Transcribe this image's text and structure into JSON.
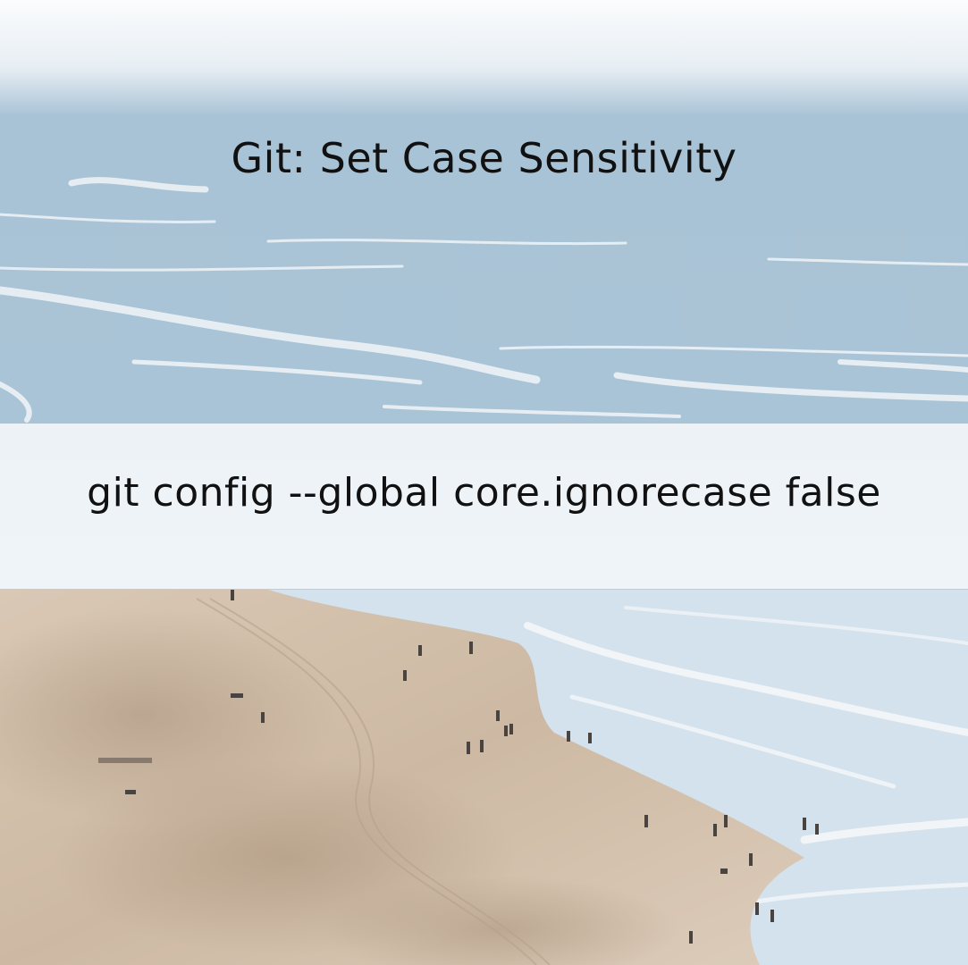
{
  "title": "Git: Set Case Sensitivity",
  "command": "git config --global core.ignorecase false",
  "background_image": {
    "subject": "aerial-beach-photo",
    "colors": {
      "sky_haze": "#f7f9fb",
      "ocean_deep": "#9cb9cf",
      "ocean_light": "#c9dbe7",
      "surf": "#eef3f6",
      "wet_sand": "#d7e3ea",
      "sand": "#d8c6b2",
      "sand_dark": "#b9a48e"
    }
  }
}
